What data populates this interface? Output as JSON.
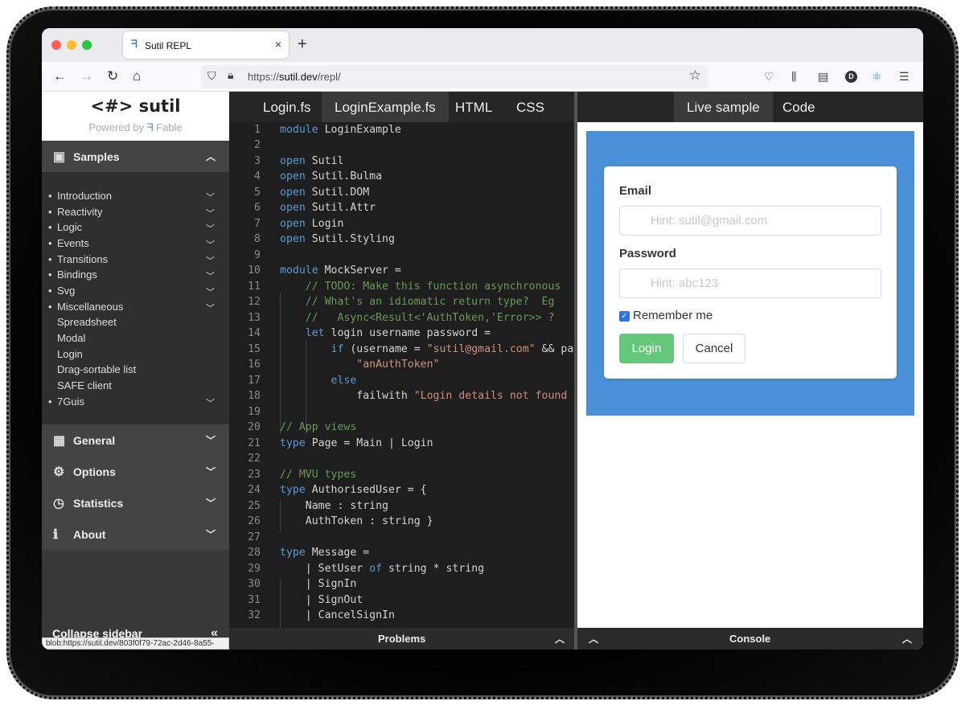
{
  "browser": {
    "tab_title": "Sutil REPL",
    "tab_close": "×",
    "new_tab": "+",
    "url_prefix": "https://",
    "url_host": "sutil.dev",
    "url_path": "/repl/",
    "avatar_letter": "D"
  },
  "sidebar": {
    "logo": "<#> sutil",
    "powered_by": "Powered by",
    "fable": "Fable",
    "samples_label": "Samples",
    "sample_items": [
      {
        "label": "Introduction",
        "expandable": true
      },
      {
        "label": "Reactivity",
        "expandable": true
      },
      {
        "label": "Logic",
        "expandable": true
      },
      {
        "label": "Events",
        "expandable": true
      },
      {
        "label": "Transitions",
        "expandable": true
      },
      {
        "label": "Bindings",
        "expandable": true
      },
      {
        "label": "Svg",
        "expandable": true
      },
      {
        "label": "Miscellaneous",
        "expandable": true
      },
      {
        "label": "Spreadsheet",
        "expandable": false
      },
      {
        "label": "Modal",
        "expandable": false
      },
      {
        "label": "Login",
        "expandable": false
      },
      {
        "label": "Drag-sortable list",
        "expandable": false
      },
      {
        "label": "SAFE client",
        "expandable": false
      },
      {
        "label": "7Guis",
        "expandable": true
      }
    ],
    "sections": [
      {
        "label": "General",
        "icon": "grid-icon"
      },
      {
        "label": "Options",
        "icon": "gear-icon"
      },
      {
        "label": "Statistics",
        "icon": "clock-icon"
      },
      {
        "label": "About",
        "icon": "info-icon"
      }
    ],
    "collapse_label": "Collapse sidebar",
    "status_url": "blob:https://sutil.dev/803f0f79-72ac-2d46-8a55-4b241fdadd75#"
  },
  "editor": {
    "tabs": [
      "Login.fs",
      "LoginExample.fs",
      "HTML",
      "CSS"
    ],
    "active_tab": "LoginExample.fs",
    "problems_label": "Problems"
  },
  "preview": {
    "tabs": [
      "Live sample",
      "Code"
    ],
    "active_tab": "Live sample",
    "email_label": "Email",
    "email_placeholder": "Hint: sutil@gmail.com",
    "password_label": "Password",
    "password_placeholder": "Hint: abc123",
    "remember_label": "Remember me",
    "remember_checked": true,
    "login_button": "Login",
    "cancel_button": "Cancel",
    "console_label": "Console"
  },
  "colors": {
    "sidebar_bg": "#383838",
    "editor_bg": "#1e1e1e",
    "keyword": "#569cd6",
    "comment": "#6a9955",
    "string": "#ce9178",
    "preview_blue": "#4a90d9",
    "login_green": "#65c77a"
  }
}
